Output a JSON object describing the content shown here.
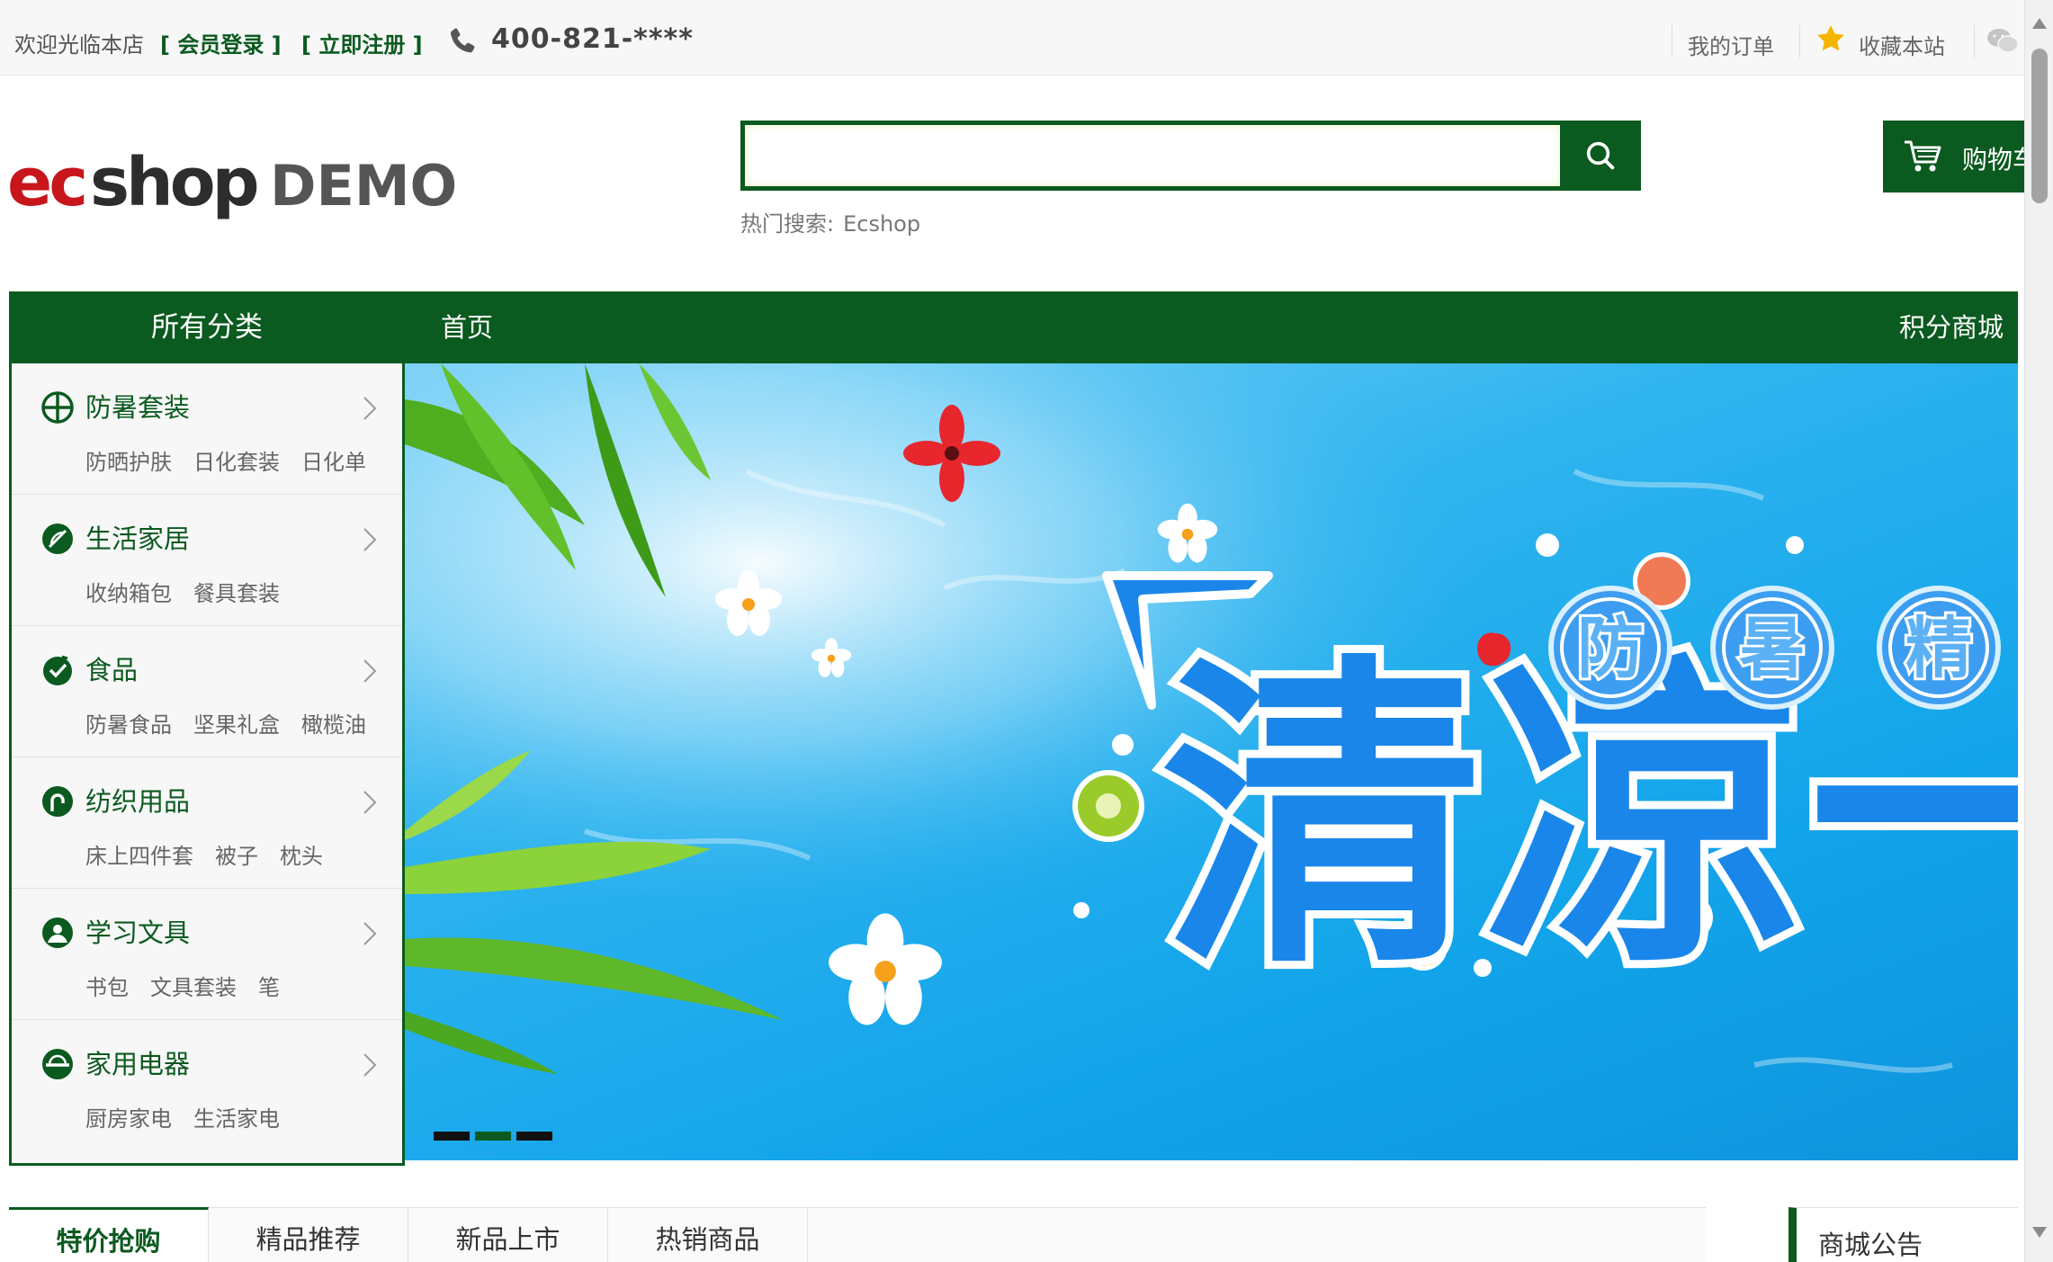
{
  "topbar": {
    "welcome": "欢迎光临本店",
    "login": "[ 会员登录 ]",
    "register": "[ 立即注册 ]",
    "phone": "400-821-****",
    "my_orders": "我的订单",
    "favorite": "收藏本站"
  },
  "header": {
    "logo_demo": "DEMO",
    "search_placeholder": "",
    "hot_label": "热门搜索:",
    "hot_keyword": "Ecshop",
    "cart_label": "购物车"
  },
  "nav": {
    "all_categories": "所有分类",
    "home": "首页",
    "points_mall": "积分商城"
  },
  "categories": [
    {
      "title": "防暑套装",
      "subs": [
        "防晒护肤",
        "日化套装",
        "日化单"
      ]
    },
    {
      "title": "生活家居",
      "subs": [
        "收纳箱包",
        "餐具套装"
      ]
    },
    {
      "title": "食品",
      "subs": [
        "防暑食品",
        "坚果礼盒",
        "橄榄油"
      ]
    },
    {
      "title": "纺织用品",
      "subs": [
        "床上四件套",
        "被子",
        "枕头"
      ]
    },
    {
      "title": "学习文具",
      "subs": [
        "书包",
        "文具套装",
        "笔"
      ]
    },
    {
      "title": "家用电器",
      "subs": [
        "厨房家电",
        "生活家电"
      ]
    }
  ],
  "banner": {
    "headline": "清凉一",
    "badges": [
      "防",
      "暑",
      "精"
    ],
    "slides": 3,
    "active_slide": 2
  },
  "tabs": [
    "特价抢购",
    "精品推荐",
    "新品上市",
    "热销商品"
  ],
  "notice": "商城公告",
  "colors": {
    "brand_green": "#0b5a1f",
    "logo_red": "#c8161d",
    "banner_blue": "#12a4ea"
  }
}
